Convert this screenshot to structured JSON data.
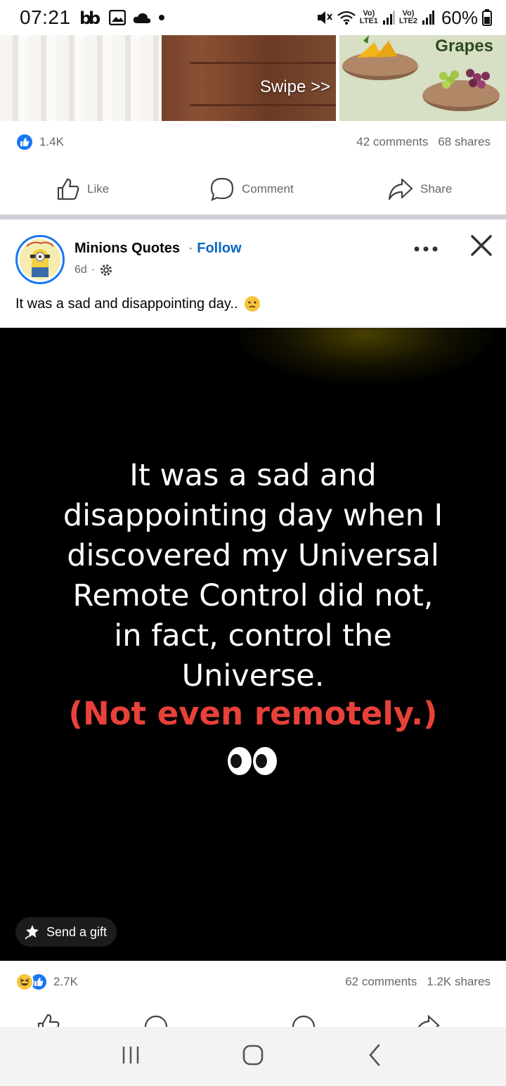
{
  "status_bar": {
    "time": "07:21",
    "lte1": "Vo)",
    "lte1_sub": "LTE1",
    "lte2": "Vo)",
    "lte2_sub": "LTE2",
    "battery": "60%"
  },
  "prev_post": {
    "swipe_label": "Swipe >>",
    "grapes_label": "Grapes",
    "reaction_count": "1.4K",
    "comments": "42 comments",
    "shares": "68 shares",
    "actions": {
      "like": "Like",
      "comment": "Comment",
      "share": "Share"
    }
  },
  "post": {
    "page_name": "Minions Quotes",
    "separator": "·",
    "follow": "Follow",
    "time": "6d",
    "caption": "It was a sad and disappointing day..",
    "image": {
      "quote_lines": [
        "It was a sad and",
        "disappointing day when I",
        "discovered my Universal",
        "Remote Control did not,",
        "in fact, control the",
        "Universe."
      ],
      "punchline": "(Not even remotely.)"
    },
    "send_gift": "Send a gift",
    "reaction_count": "2.7K",
    "comments": "62 comments",
    "shares": "1.2K shares"
  },
  "colors": {
    "brand_blue": "#1877f2",
    "link_blue": "#0866c2",
    "punch_red": "#e8413a",
    "meta_gray": "#65676b"
  },
  "icons": [
    "like-icon",
    "comment-icon",
    "share-icon",
    "settings-icon",
    "more-icon",
    "close-icon",
    "gift-icon",
    "recent-apps-icon",
    "home-icon",
    "back-icon"
  ]
}
